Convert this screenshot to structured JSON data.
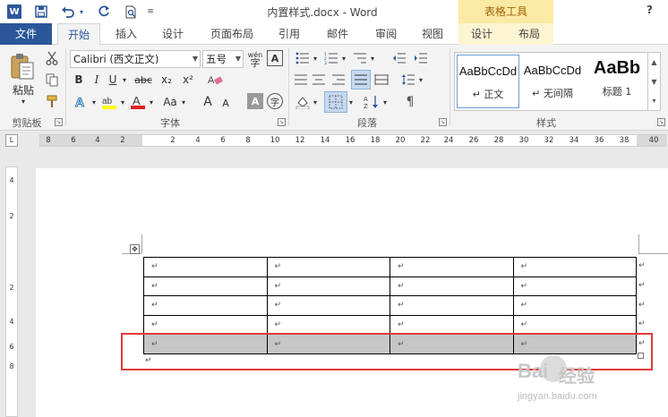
{
  "window": {
    "title": "内置样式.docx - Word",
    "context_tab_group": "表格工具",
    "help": "?"
  },
  "tabs": [
    {
      "label": "文件"
    },
    {
      "label": "开始"
    },
    {
      "label": "插入"
    },
    {
      "label": "设计"
    },
    {
      "label": "页面布局"
    },
    {
      "label": "引用"
    },
    {
      "label": "邮件"
    },
    {
      "label": "审阅"
    },
    {
      "label": "视图"
    },
    {
      "label": "设计"
    },
    {
      "label": "布局"
    }
  ],
  "ribbon": {
    "clipboard": {
      "label": "剪贴板",
      "paste_label": "粘贴"
    },
    "font": {
      "label": "字体",
      "font_name": "Calibri (西文正文)",
      "font_size": "五号",
      "wen_label": "wén",
      "bold": "B",
      "italic": "I",
      "underline": "U",
      "strike": "abc",
      "subscript": "x₂",
      "superscript": "x²",
      "grow": "A",
      "shrink": "A",
      "case": "Aa",
      "font_color": "A",
      "char_shade": "A",
      "char_border": "A",
      "circle": "字"
    },
    "paragraph": {
      "label": "段落"
    },
    "styles": {
      "label": "样式",
      "items": [
        {
          "sample": "AaBbCcDd",
          "name": "↵ 正文"
        },
        {
          "sample": "AaBbCcDd",
          "name": "↵ 无间隔"
        },
        {
          "sample": "AaBb",
          "name": "标题 1"
        }
      ]
    }
  },
  "ruler": {
    "corner": "L",
    "ticks": [
      "8",
      "6",
      "4",
      "2",
      "2",
      "4",
      "6",
      "8",
      "10",
      "12",
      "14",
      "16",
      "18",
      "20",
      "22",
      "24",
      "26",
      "28",
      "30",
      "32",
      "34",
      "36",
      "38",
      "40"
    ],
    "vticks": [
      "4",
      "2",
      "2",
      "4",
      "6",
      "8"
    ]
  },
  "document": {
    "cell_mark": "↵",
    "rows": [
      [
        "↵",
        "↵",
        "↵",
        "↵"
      ],
      [
        "↵",
        "↵",
        "↵",
        "↵"
      ],
      [
        "↵",
        "↵",
        "↵",
        "↵"
      ],
      [
        "↵",
        "↵",
        "↵",
        "↵"
      ],
      [
        "↵",
        "↵",
        "↵",
        "↵"
      ]
    ],
    "selected_row_index": 4,
    "end_paragraph_mark": "↵"
  },
  "watermark": {
    "brand": "Bai",
    "brand2": "经验",
    "url": "jingyan.baidu.com"
  }
}
